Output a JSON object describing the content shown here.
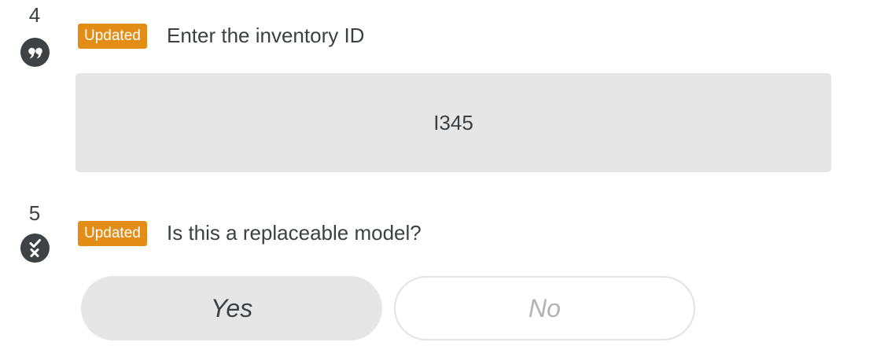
{
  "questions": [
    {
      "number": "4",
      "icon": "quote-icon",
      "badge": "Updated",
      "text": "Enter the inventory ID",
      "answer": "I345"
    },
    {
      "number": "5",
      "icon": "yes-no-icon",
      "badge": "Updated",
      "text": "Is this a replaceable model?",
      "options": [
        "Yes",
        "No"
      ],
      "selected": "Yes"
    }
  ],
  "colors": {
    "badge": "#e38d16",
    "icon_bg": "#3e4245",
    "answer_bg": "#e6e6e6",
    "unselected_text": "#b3b3b3"
  }
}
